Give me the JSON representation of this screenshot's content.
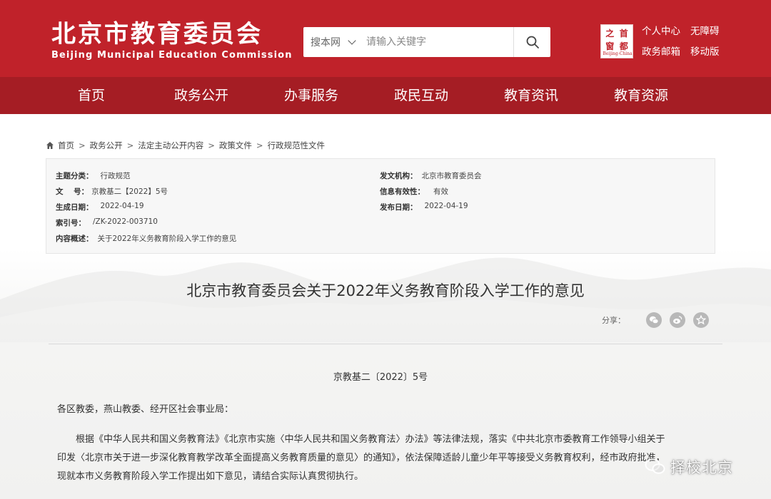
{
  "header": {
    "brand_cn": "北京市教育委员会",
    "brand_en": "Beijing Municipal Education Commission",
    "search": {
      "scope_label": "搜本网",
      "placeholder": "请输入关键字"
    },
    "seal": {
      "chars": [
        "首",
        "都",
        "之",
        "窗"
      ],
      "caption": "Beijing-China"
    },
    "top_links": [
      "个人中心",
      "无障碍",
      "政务邮箱",
      "移动版"
    ]
  },
  "nav": {
    "items": [
      "首页",
      "政务公开",
      "办事服务",
      "政民互动",
      "教育资讯",
      "教育资源"
    ]
  },
  "breadcrumb": {
    "items": [
      "首页",
      "政务公开",
      "法定主动公开内容",
      "政策文件",
      "行政规范性文件"
    ],
    "separator": ">"
  },
  "meta": {
    "topic_label": "主题分类：",
    "topic_value": "行政规范",
    "issuer_label": "发文机构：",
    "issuer_value": "北京市教育委员会",
    "docno_label": "文    号：",
    "docno_value": "京教基二【2022】5号",
    "validity_label": "信息有效性：",
    "validity_value": "有效",
    "created_label": "生成日期：",
    "created_value": "2022-04-19",
    "published_label": "发布日期：",
    "published_value": "2022-04-19",
    "index_label": "索引号：",
    "index_value": "/ZK-2022-003710",
    "summary_label": "内容概述：",
    "summary_value": "关于2022年义务教育阶段入学工作的意见"
  },
  "document": {
    "title": "北京市教育委员会关于2022年义务教育阶段入学工作的意见",
    "share_label": "分享：",
    "doc_number": "京教基二〔2022〕5号",
    "salutation": "各区教委，燕山教委、经开区社会事业局：",
    "paragraph_lines": [
      "根据《中华人民共和国义务教育法》《北京市实施〈中华人民共和国义务教育法〉办法》等法律法规，落实《中共北京市委教育工作领导小组关于",
      "印发〈北京市关于进一步深化教育教学改革全面提高义务教育质量的意见〉的通知》，依法保障适龄儿童少年平等接受义务教育权利，经市政府批准，",
      "现就本市义务教育阶段入学工作提出如下意见，请结合实际认真贯彻执行。"
    ]
  },
  "watermark": {
    "text": "择校北京"
  },
  "colors": {
    "header_red": "#c0222a",
    "nav_red": "#a51d24"
  }
}
